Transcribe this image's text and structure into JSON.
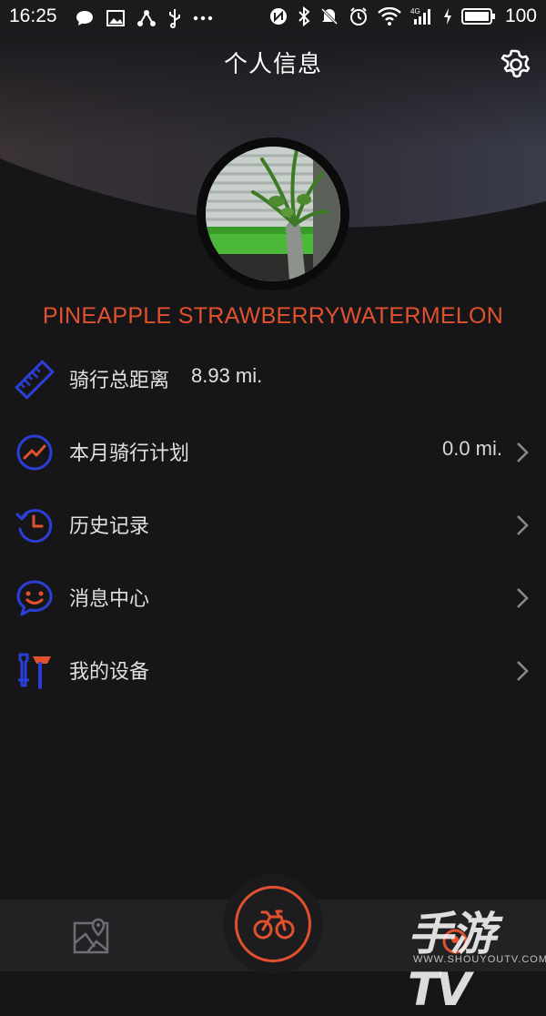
{
  "status_bar": {
    "time": "16:25",
    "left_icons": [
      "chat-icon",
      "gallery-icon",
      "share-icon",
      "usb-icon",
      "more-icon"
    ],
    "right_icons": [
      "nfc-icon",
      "bluetooth-icon",
      "mute-icon",
      "alarm-icon",
      "wifi-icon",
      "signal-4g-icon",
      "charging-icon",
      "battery-icon"
    ],
    "battery": "100"
  },
  "header": {
    "title": "个人信息"
  },
  "profile": {
    "username": "PINEAPPLE STRAWBERRYWATERMELON"
  },
  "menu": [
    {
      "label": "骑行总距离",
      "value": "8.93  mi.",
      "icon": "ruler-icon"
    },
    {
      "label": "本月骑行计划",
      "value": "0.0 mi.",
      "icon": "plan-chart-icon"
    },
    {
      "label": "历史记录",
      "icon": "history-clock-icon"
    },
    {
      "label": "消息中心",
      "icon": "message-smiley-icon"
    },
    {
      "label": "我的设备",
      "icon": "tools-icon"
    }
  ],
  "tabbar": {
    "items": [
      "map-icon",
      "bicycle-icon",
      "profile-icon"
    ]
  },
  "watermark": {
    "text": "手游TV",
    "sub": "WWW.SHOUYOUTV.COM"
  },
  "colors": {
    "accent": "#e2512d",
    "icon_blue": "#2b3fd6",
    "background": "#161618"
  }
}
